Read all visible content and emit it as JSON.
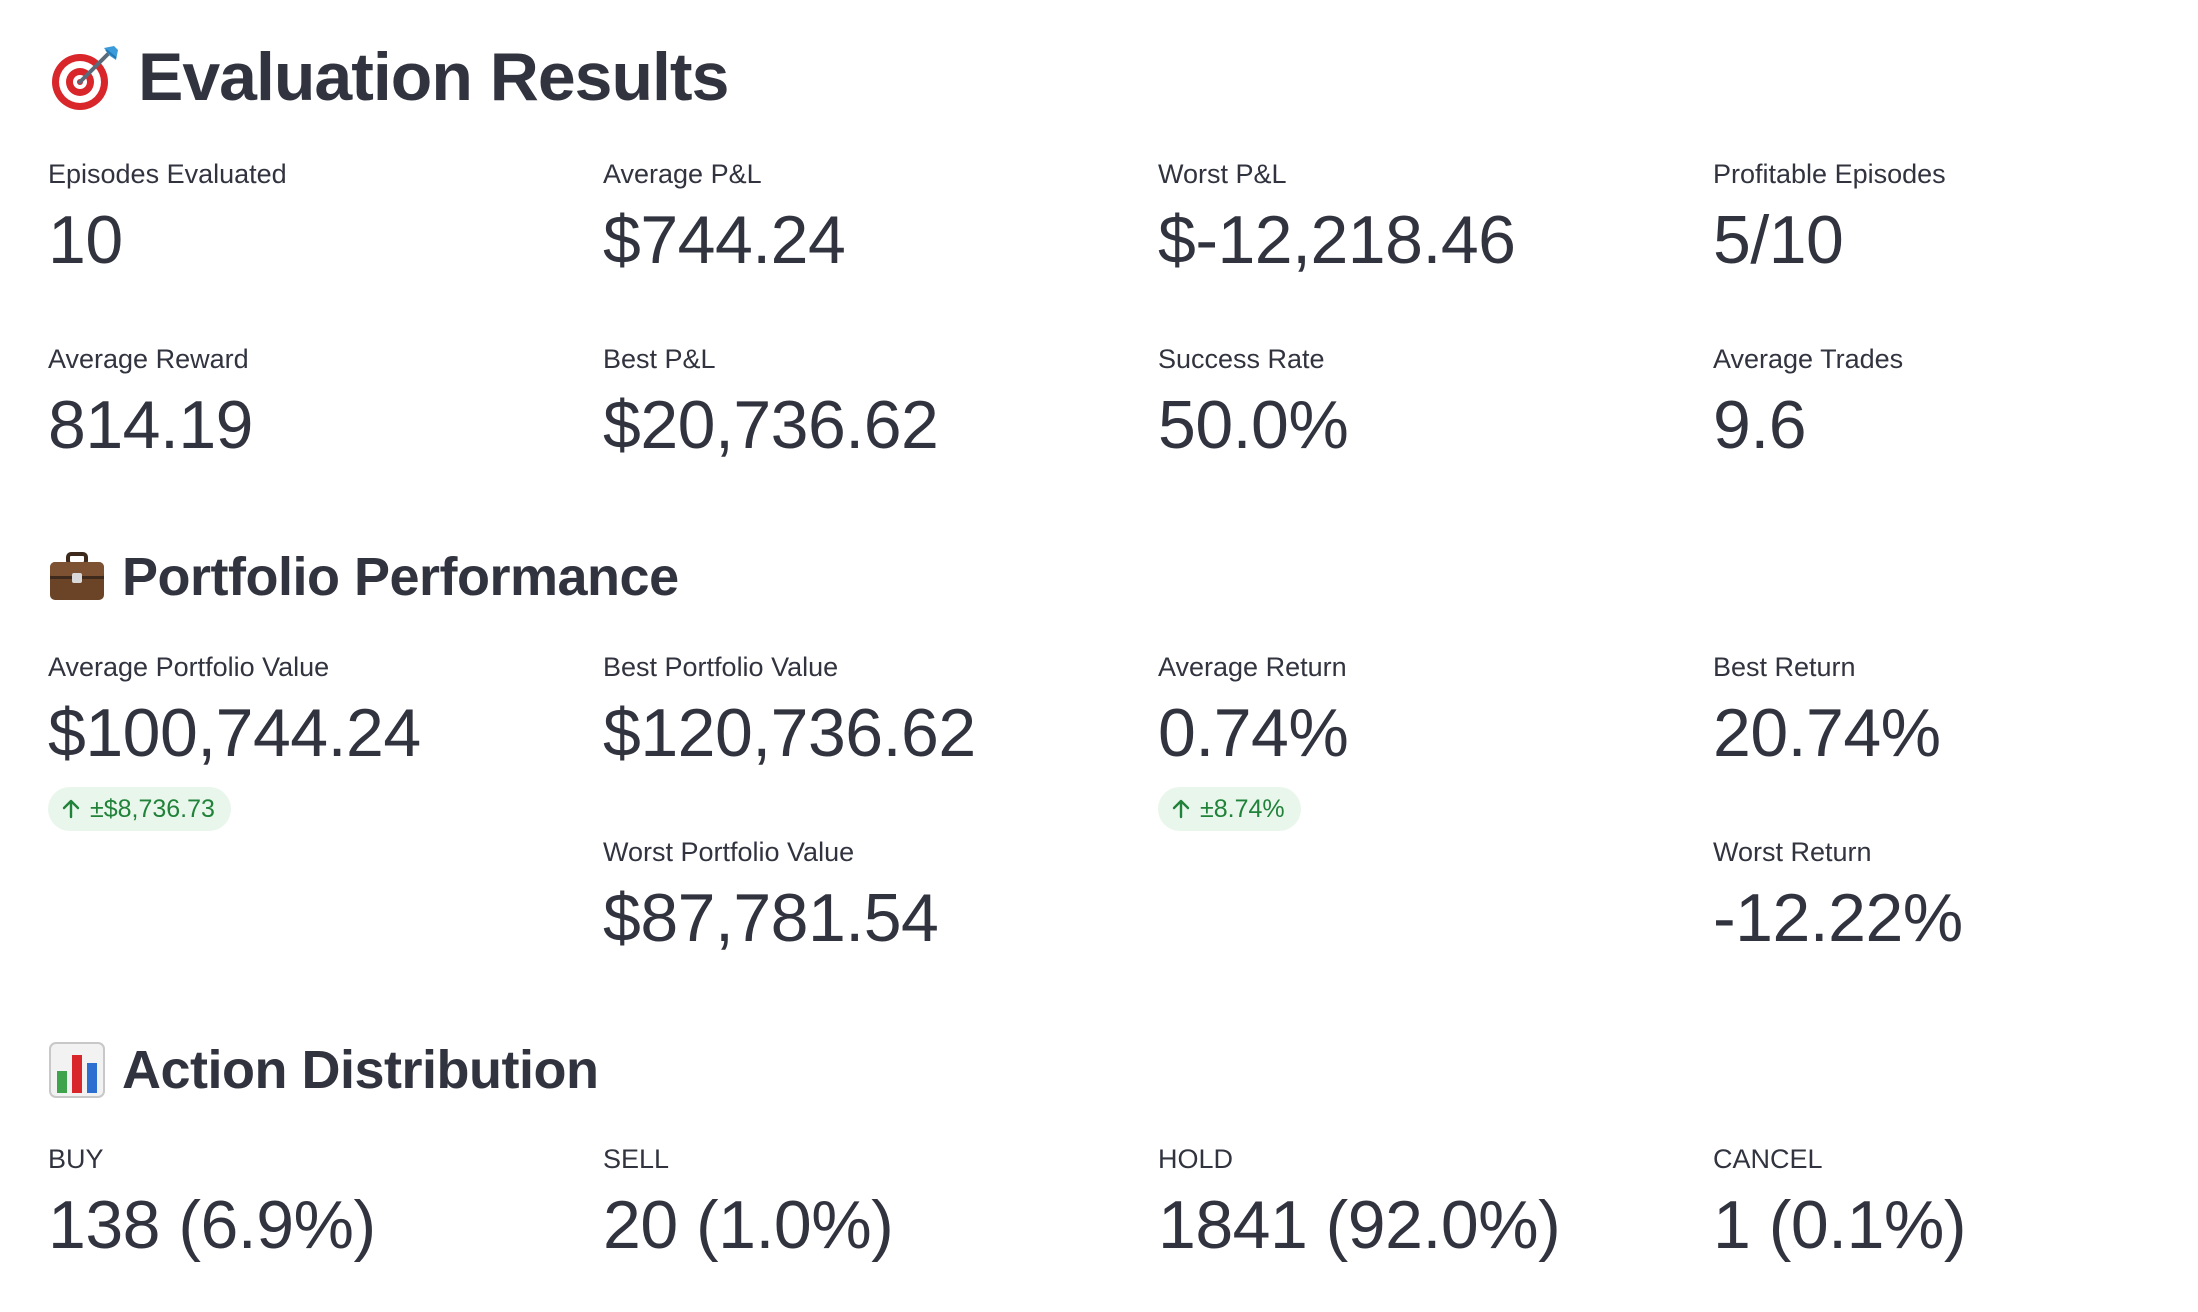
{
  "evaluation": {
    "icon": "dart-target-icon",
    "title": "Evaluation Results",
    "metrics": [
      {
        "label": "Episodes Evaluated",
        "value": "10"
      },
      {
        "label": "Average P&L",
        "value": "$744.24"
      },
      {
        "label": "Worst P&L",
        "value": "$-12,218.46"
      },
      {
        "label": "Profitable Episodes",
        "value": "5/10"
      },
      {
        "label": "Average Reward",
        "value": "814.19"
      },
      {
        "label": "Best P&L",
        "value": "$20,736.62"
      },
      {
        "label": "Success Rate",
        "value": "50.0%"
      },
      {
        "label": "Average Trades",
        "value": "9.6"
      }
    ]
  },
  "portfolio": {
    "icon": "briefcase-icon",
    "title": "Portfolio Performance",
    "metrics": [
      {
        "label": "Average Portfolio Value",
        "value": "$100,744.24",
        "delta": "±$8,736.73"
      },
      {
        "label": "Best Portfolio Value",
        "value": "$120,736.62"
      },
      {
        "label": "Worst Portfolio Value",
        "value": "$87,781.54"
      },
      {
        "label": "Average Return",
        "value": "0.74%",
        "delta": "±8.74%"
      },
      {
        "label": "Best Return",
        "value": "20.74%"
      },
      {
        "label": "Worst Return",
        "value": "-12.22%"
      }
    ]
  },
  "actions": {
    "icon": "bar-chart-icon",
    "title": "Action Distribution",
    "metrics": [
      {
        "label": "BUY",
        "value": "138 (6.9%)"
      },
      {
        "label": "SELL",
        "value": "20 (1.0%)"
      },
      {
        "label": "HOLD",
        "value": "1841 (92.0%)"
      },
      {
        "label": "CANCEL",
        "value": "1 (0.1%)"
      }
    ]
  },
  "colors": {
    "text": "#31333f",
    "delta_bg": "#e9f6ec",
    "delta_text": "#21823a"
  }
}
